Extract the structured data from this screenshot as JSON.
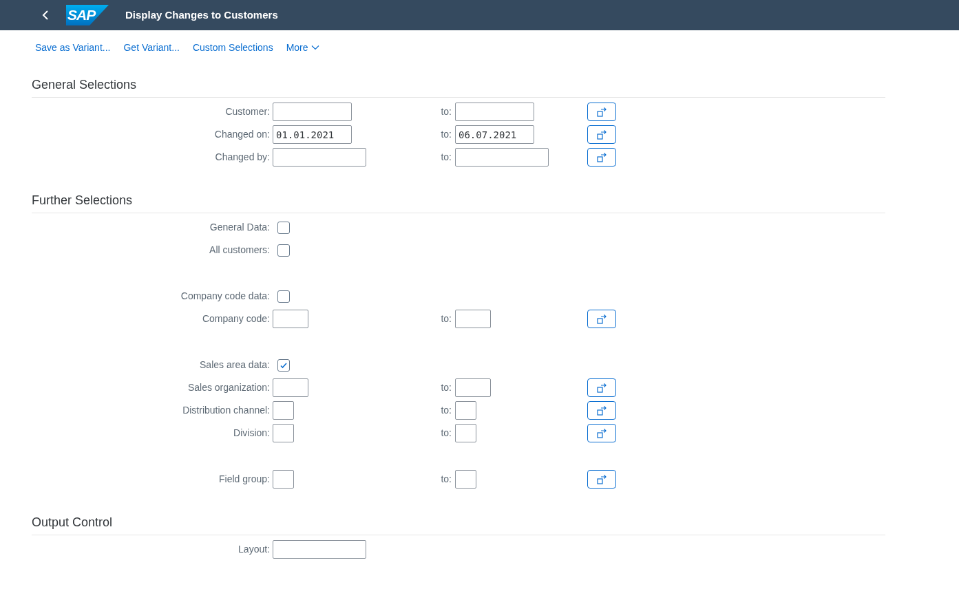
{
  "header": {
    "title": "Display Changes to Customers",
    "logo": "SAP"
  },
  "toolbar": [
    {
      "label": "Save as Variant...",
      "kind": "link"
    },
    {
      "label": "Get Variant...",
      "kind": "link"
    },
    {
      "label": "Custom Selections",
      "kind": "link"
    },
    {
      "label": "More",
      "kind": "menu"
    }
  ],
  "sections": [
    {
      "title": "General Selections",
      "groups": [
        [
          {
            "kind": "range",
            "label": "Customer:",
            "to_label": "to:"
          },
          {
            "kind": "range",
            "label": "Changed on:",
            "value": "01.01.2021",
            "to_label": "to:",
            "to_value": "06.07.2021"
          },
          {
            "kind": "range",
            "label": "Changed by:",
            "to_label": "to:"
          }
        ]
      ]
    },
    {
      "title": "Further Selections",
      "groups": [
        [
          {
            "kind": "checkbox",
            "label": "General Data:",
            "checked": false
          },
          {
            "kind": "checkbox",
            "label": "All customers:",
            "checked": false
          }
        ],
        [
          {
            "kind": "checkbox",
            "label": "Company code data:",
            "checked": false
          },
          {
            "kind": "range",
            "label": "Company code:",
            "to_label": "to:"
          }
        ],
        [
          {
            "kind": "checkbox",
            "label": "Sales area data:",
            "checked": true
          },
          {
            "kind": "range",
            "label": "Sales organization:",
            "to_label": "to:"
          },
          {
            "kind": "range",
            "label": "Distribution channel:",
            "to_label": "to:"
          },
          {
            "kind": "range",
            "label": "Division:",
            "to_label": "to:"
          }
        ],
        [
          {
            "kind": "range",
            "label": "Field group:",
            "to_label": "to:"
          }
        ]
      ]
    },
    {
      "title": "Output Control",
      "groups": [
        [
          {
            "kind": "single",
            "label": "Layout:"
          }
        ]
      ]
    }
  ]
}
